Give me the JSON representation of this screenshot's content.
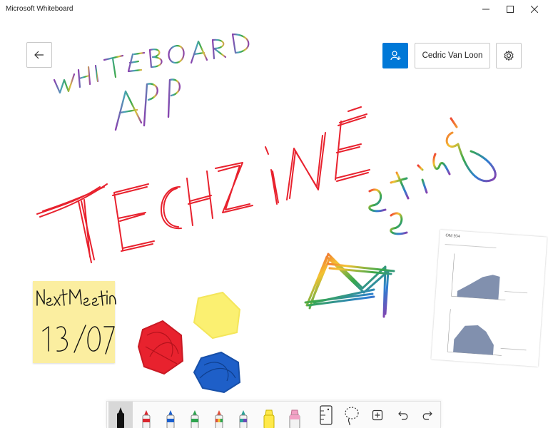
{
  "window": {
    "title": "Microsoft Whiteboard"
  },
  "header": {
    "user_name": "Cedric Van Loon"
  },
  "board": {
    "ink_colors": {
      "red": "#e8222e",
      "yellow": "#fbf071",
      "blue": "#1e5fc8",
      "purple": "#8a3fae",
      "teal": "#4aa3b8",
      "green": "#38a84c"
    },
    "sticky_note": {
      "color": "#fbeea0"
    },
    "document_card": {
      "title": "OM 934"
    }
  },
  "toolbar": {
    "tools": [
      {
        "name": "black-pen",
        "color": "#111111"
      },
      {
        "name": "red-pen",
        "color": "#d9262e"
      },
      {
        "name": "blue-pen",
        "color": "#1a5fcf"
      },
      {
        "name": "green-pen",
        "color": "#2ea44f"
      },
      {
        "name": "rainbow-pen",
        "color": "#e0503a"
      },
      {
        "name": "galaxy-pen",
        "color": "#2aa198"
      },
      {
        "name": "yellow-highlighter",
        "color": "#ffe94a"
      },
      {
        "name": "pink-highlighter",
        "color": "#f2a1c5"
      }
    ]
  }
}
